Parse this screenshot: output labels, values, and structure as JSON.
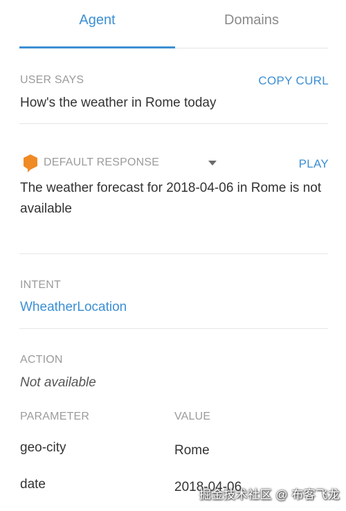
{
  "tabs": [
    {
      "label": "Agent",
      "active": true
    },
    {
      "label": "Domains",
      "active": false
    }
  ],
  "user_says": {
    "label": "USER SAYS",
    "copy_curl_label": "COPY CURL",
    "text": "How's the weather in Rome today"
  },
  "response": {
    "icon": "speech-bubble-icon",
    "icon_color": "#f08a24",
    "label": "DEFAULT RESPONSE",
    "play_label": "PLAY",
    "text": "The weather forecast for 2018-04-06 in Rome is not available"
  },
  "intent": {
    "label": "INTENT",
    "value": "WheatherLocation"
  },
  "action": {
    "label": "ACTION",
    "value": "Not available"
  },
  "parameters": {
    "header_parameter": "PARAMETER",
    "header_value": "VALUE",
    "rows": [
      {
        "name": "geo-city",
        "value": "Rome"
      },
      {
        "name": "date",
        "value": "2018-04-06"
      }
    ]
  },
  "watermark": "掘金技术社区 @ 布客飞龙",
  "colors": {
    "accent": "#3c8fd3",
    "label_gray": "#9b9b9b",
    "text": "#333333"
  }
}
